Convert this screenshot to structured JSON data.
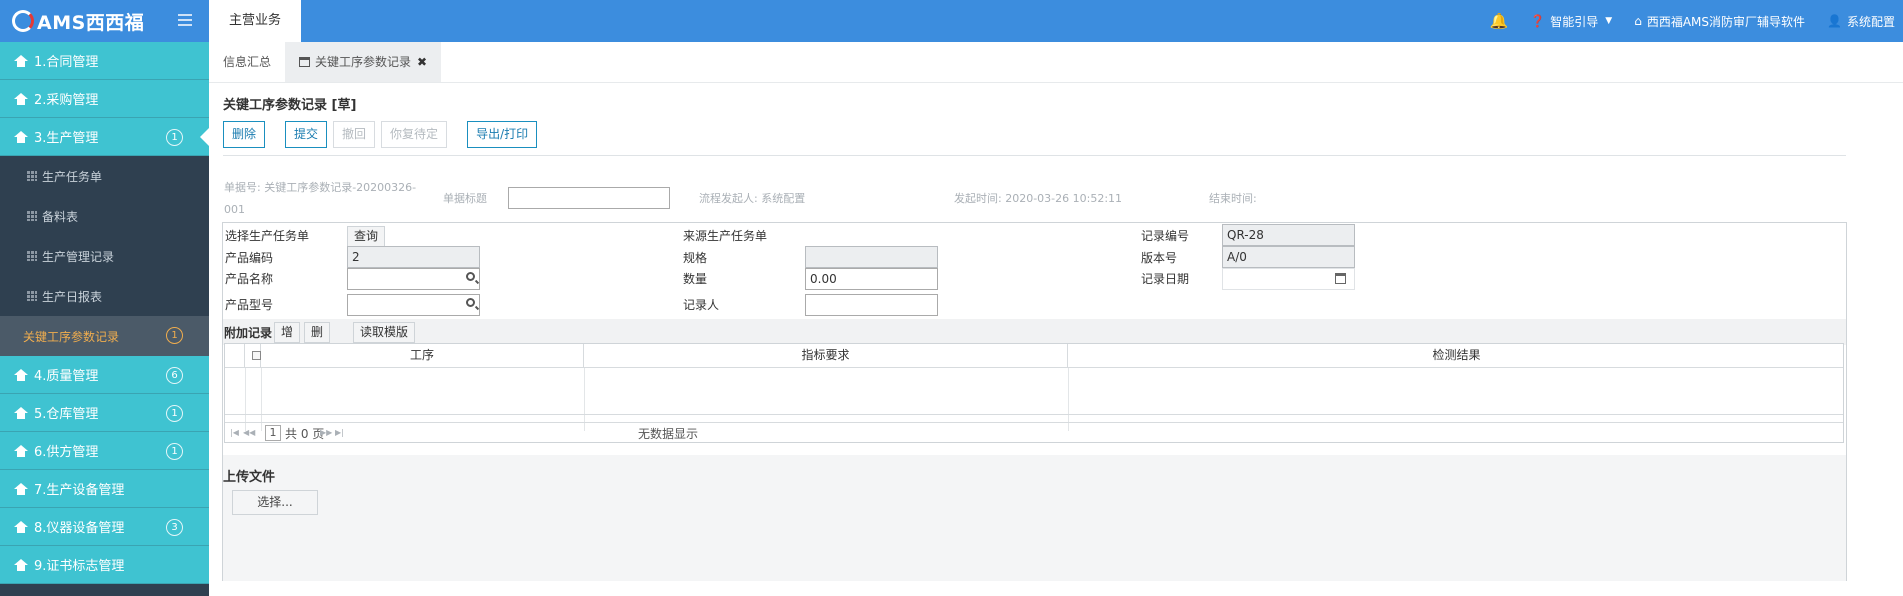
{
  "header": {
    "logo_text": "AMS西西福",
    "top_tab": "主营业务",
    "bell_icon": "bell-icon",
    "guide": "智能引导",
    "company": "西西福AMS消防审厂辅导软件",
    "settings": "系统配置"
  },
  "sidebar": {
    "items": [
      {
        "label": "1.合同管理"
      },
      {
        "label": "2.采购管理"
      },
      {
        "label": "3.生产管理",
        "badge": "1"
      },
      {
        "label": "生产任务单"
      },
      {
        "label": "备料表"
      },
      {
        "label": "生产管理记录"
      },
      {
        "label": "生产日报表"
      },
      {
        "label": "关键工序参数记录",
        "badge": "1"
      },
      {
        "label": "4.质量管理",
        "badge": "6"
      },
      {
        "label": "5.仓库管理",
        "badge": "1"
      },
      {
        "label": "6.供方管理",
        "badge": "1"
      },
      {
        "label": "7.生产设备管理"
      },
      {
        "label": "8.仪器设备管理",
        "badge": "3"
      },
      {
        "label": "9.证书标志管理"
      }
    ]
  },
  "tabs": {
    "summary": "信息汇总",
    "current": "关键工序参数记录"
  },
  "page": {
    "title": "关键工序参数记录 [草]",
    "buttons": {
      "delete": "删除",
      "submit": "提交",
      "withdraw": "撤回",
      "pending": "你复待定",
      "export": "导出/打印"
    },
    "meta": {
      "doc_no_label": "单据号:",
      "doc_no": "关键工序参数记录-20200326-",
      "doc_no2": "001",
      "doc_title_label": "单据标题",
      "initiator_label": "流程发起人:",
      "initiator": "系统配置",
      "start_time_label": "发起时间:",
      "start_time": "2020-03-26 10:52:11",
      "end_time_label": "结束时间:"
    }
  },
  "form": {
    "select_task_label": "选择生产任务单",
    "query_btn": "查询",
    "source_task_label": "来源生产任务单",
    "record_no_label": "记录编号",
    "record_no": "QR-28",
    "product_code_label": "产品编码",
    "product_code": "2",
    "spec_label": "规格",
    "version_label": "版本号",
    "version": "A/0",
    "product_name_label": "产品名称",
    "quantity_label": "数量",
    "quantity": "0.00",
    "record_date_label": "记录日期",
    "product_model_label": "产品型号",
    "recorder_label": "记录人"
  },
  "attach": {
    "title": "附加记录",
    "add": "增",
    "del": "删",
    "read_template": "读取模版",
    "columns": [
      "工序",
      "指标要求",
      "检测结果"
    ],
    "page_input": "1",
    "page_total": "共 0 页",
    "empty": "无数据显示"
  },
  "upload": {
    "title": "上传文件",
    "choose": "选择..."
  }
}
